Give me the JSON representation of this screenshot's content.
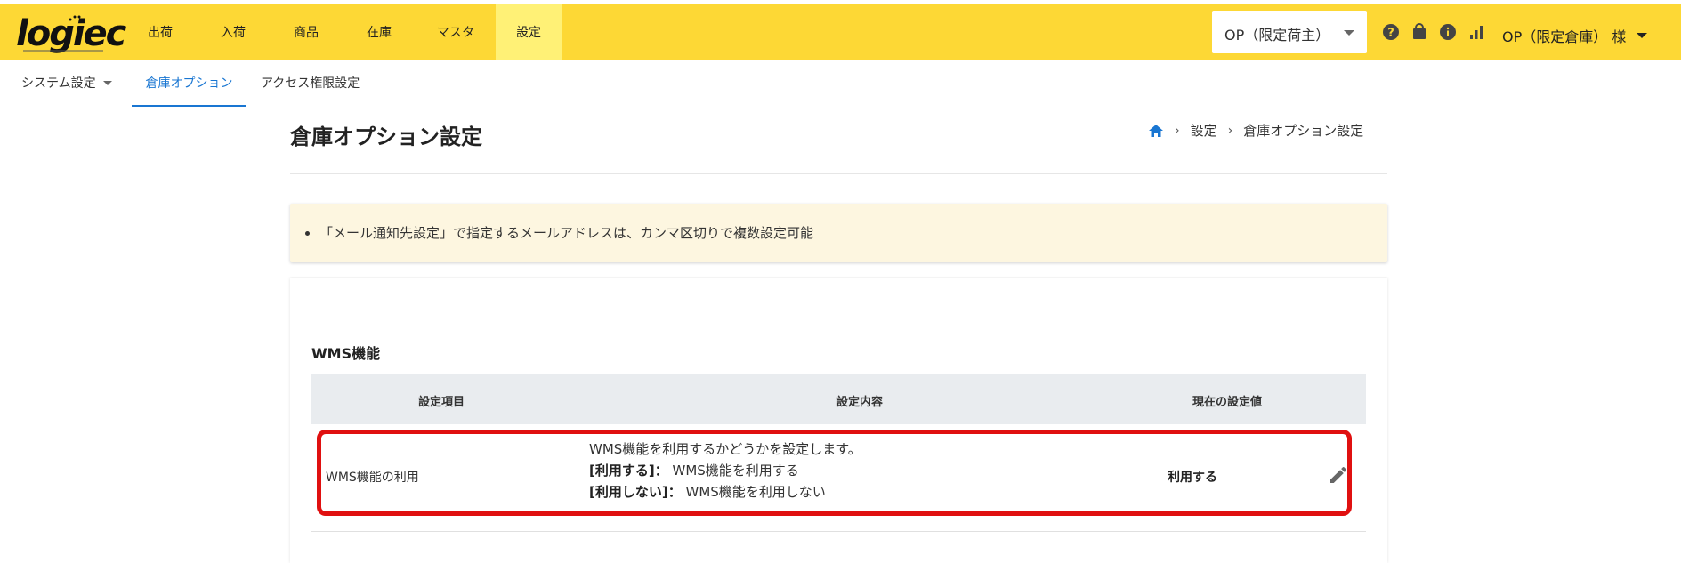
{
  "logo": {
    "text": "logiec"
  },
  "nav": {
    "items": [
      {
        "label": "出荷"
      },
      {
        "label": "入荷"
      },
      {
        "label": "商品"
      },
      {
        "label": "在庫"
      },
      {
        "label": "マスタ"
      },
      {
        "label": "設定"
      }
    ],
    "active_index": 5
  },
  "header": {
    "owner_select_value": "OP（限定荷主）",
    "user_menu_label": "OP（限定倉庫） 様",
    "icons": [
      "help-icon",
      "shopping-bag-icon",
      "info-icon",
      "signal-bars-icon"
    ]
  },
  "subnav": {
    "items": [
      {
        "label": "システム設定",
        "dropdown": true
      },
      {
        "label": "倉庫オプション",
        "active": true
      },
      {
        "label": "アクセス権限設定"
      }
    ]
  },
  "page": {
    "title": "倉庫オプション設定",
    "breadcrumb": {
      "home_icon": "home-icon",
      "items": [
        "設定",
        "倉庫オプション設定"
      ]
    }
  },
  "notice": {
    "items": [
      "「メール通知先設定」で指定するメールアドレスは、カンマ区切りで複数設定可能"
    ]
  },
  "section": {
    "title": "WMS機能",
    "columns": [
      "設定項目",
      "設定内容",
      "現在の設定値"
    ],
    "rows": [
      {
        "name": "WMS機能の利用",
        "desc_line1": "WMS機能を利用するかどうかを設定します。",
        "desc_line2_key": "[利用する]：",
        "desc_line2_val": " WMS機能を利用する",
        "desc_line3_key": "[利用しない]：",
        "desc_line3_val": " WMS機能を利用しない",
        "value": "利用する",
        "edit_icon": "pencil-icon"
      }
    ]
  },
  "colors": {
    "topbar": "#fdd835",
    "active_nav": "#fff176",
    "link": "#1976d2",
    "notice_bg": "#fdf6e0",
    "table_head": "#e9ecef",
    "highlight": "#e01010"
  }
}
